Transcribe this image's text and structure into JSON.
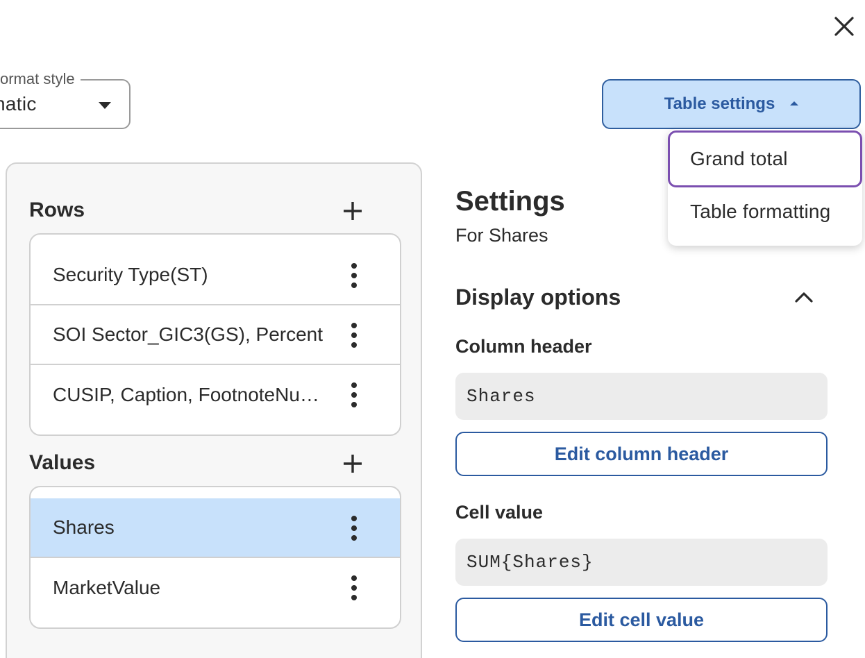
{
  "header": {
    "close_icon": "close-icon",
    "format_style": {
      "label": "ormat style",
      "value": "natic"
    },
    "table_settings": {
      "label": "Table settings",
      "caret_icon": "caret-up-icon"
    }
  },
  "table_settings_menu": {
    "items": [
      {
        "label": "Grand total",
        "focused": true
      },
      {
        "label": "Table formatting",
        "focused": false
      }
    ]
  },
  "left_panel": {
    "rows": {
      "title": "Rows",
      "add_icon": "plus-icon",
      "items": [
        {
          "label": "Security Type(ST)"
        },
        {
          "label": "SOI Sector_GIC3(GS), Percent"
        },
        {
          "label": "CUSIP, Caption, FootnoteNumber"
        }
      ]
    },
    "values": {
      "title": "Values",
      "add_icon": "plus-icon",
      "items": [
        {
          "label": "Shares",
          "selected": true
        },
        {
          "label": "MarketValue",
          "selected": false
        }
      ]
    }
  },
  "settings": {
    "title": "Settings",
    "subtitle": "For Shares",
    "display_options": {
      "title": "Display options",
      "collapse_icon": "chevron-up-icon",
      "column_header": {
        "label": "Column header",
        "value": "Shares",
        "button": "Edit column header"
      },
      "cell_value": {
        "label": "Cell value",
        "value": "SUM{Shares}",
        "button": "Edit cell value"
      }
    }
  },
  "colors": {
    "accent": "#2b5aa0",
    "selected_bg": "#c8e1fb",
    "focus_ring": "#7b4fb0"
  }
}
